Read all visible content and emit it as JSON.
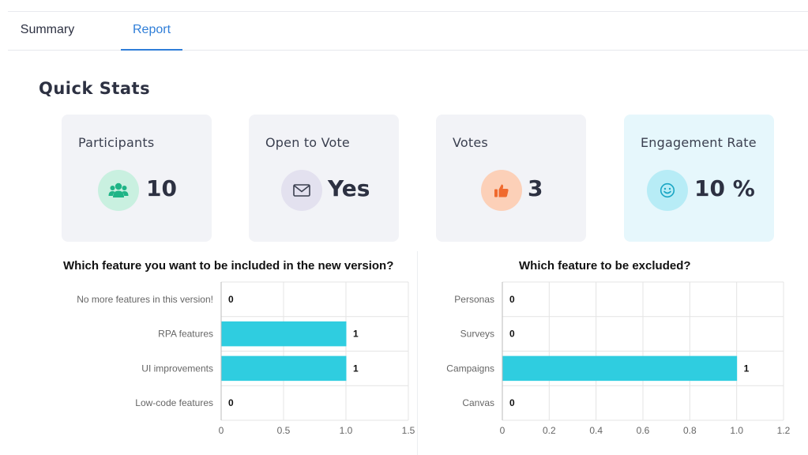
{
  "tabs": [
    {
      "label": "Summary",
      "active": false
    },
    {
      "label": "Report",
      "active": true
    }
  ],
  "section_title": "Quick Stats",
  "stats": [
    {
      "label": "Participants",
      "value": "10",
      "icon": "users-icon",
      "icon_bg": "#c9f0e0",
      "icon_color": "#1fb486"
    },
    {
      "label": "Open to Vote",
      "value": "Yes",
      "icon": "envelope-icon",
      "icon_bg": "#e3e1ef",
      "icon_color": "#3a3f4f"
    },
    {
      "label": "Votes",
      "value": "3",
      "icon": "thumbs-up-icon",
      "icon_bg": "#fcd0b8",
      "icon_color": "#f06a2e"
    },
    {
      "label": "Engagement Rate",
      "value": "10 %",
      "icon": "smiley-icon",
      "icon_bg": "#b7ecf6",
      "icon_color": "#1aa6c4"
    }
  ],
  "colors": {
    "accent": "#2f7ed8",
    "bar": "#2fcde0",
    "highlight_card": "#e6f7fc",
    "card": "#f2f3f7"
  },
  "chart_data": [
    {
      "type": "bar",
      "orientation": "horizontal",
      "title": "Which feature you want to be included in the new version?",
      "categories": [
        "No more features in this version!",
        "RPA features",
        "UI improvements",
        "Low-code features"
      ],
      "values": [
        0,
        1,
        1,
        0
      ],
      "xlim": [
        0,
        1.5
      ],
      "xticks": [
        "0",
        "0.5",
        "1.0",
        "1.5"
      ],
      "grid": true
    },
    {
      "type": "bar",
      "orientation": "horizontal",
      "title": "Which feature to be excluded?",
      "categories": [
        "Personas",
        "Surveys",
        "Campaigns",
        "Canvas"
      ],
      "values": [
        0,
        0,
        1,
        0
      ],
      "xlim": [
        0,
        1.2
      ],
      "xticks": [
        "0",
        "0.2",
        "0.4",
        "0.6",
        "0.8",
        "1.0",
        "1.2"
      ],
      "grid": true
    }
  ]
}
